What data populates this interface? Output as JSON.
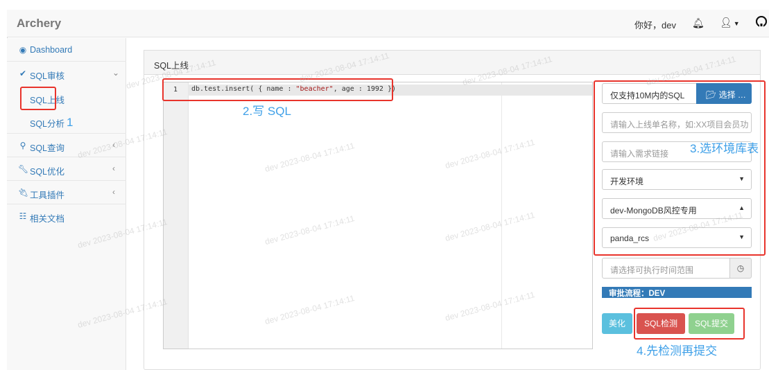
{
  "app": {
    "brand": "Archery"
  },
  "header": {
    "greeting": "你好，dev",
    "bell_icon": "bell-icon",
    "user_icon": "user-icon",
    "github_icon": "github-icon"
  },
  "sidebar": {
    "items": [
      {
        "label": "Dashboard",
        "icon": "dashboard-icon"
      },
      {
        "label": "SQL审核",
        "icon": "check-icon",
        "expanded": true
      },
      {
        "label": "SQL上线"
      },
      {
        "label": "SQL分析"
      },
      {
        "label": "SQL查询",
        "icon": "search-icon"
      },
      {
        "label": "SQL优化",
        "icon": "wrench-icon"
      },
      {
        "label": "工具插件",
        "icon": "plug-icon"
      },
      {
        "label": "相关文档",
        "icon": "sitemap-icon"
      }
    ]
  },
  "panel": {
    "title": "SQL上线"
  },
  "editor": {
    "line_number": "1",
    "code_prefix": "db.test.insert( { name : ",
    "code_string": "\"beacher\"",
    "code_suffix": ", age : 1992 })"
  },
  "form": {
    "file_note": "仅支持10M内的SQL",
    "file_button": "选择 …",
    "title_placeholder": "请输入上线单名称，如:XX项目会员功能建表",
    "demand_placeholder": "请输入需求链接",
    "environment": "开发环境",
    "instance": "dev-MongoDB风控专用",
    "database": "panda_rcs",
    "time_placeholder": "请选择可执行时间范围",
    "workflow": "审批流程：DEV"
  },
  "buttons": {
    "beautify": "美化",
    "check": "SQL检测",
    "submit": "SQL提交"
  },
  "annotations": {
    "step1": "1",
    "step2": "2.写 SQL",
    "step3": "3.选环境库表",
    "step4": "4.先检测再提交"
  },
  "watermark": "dev 2023-08-04 17:14:11",
  "colors": {
    "primary": "#337ab7",
    "danger": "#d9534f",
    "success": "#8fd18f",
    "info": "#5bc0de",
    "annotation_red": "#e8332b",
    "annotation_blue": "#3fa0e8"
  }
}
